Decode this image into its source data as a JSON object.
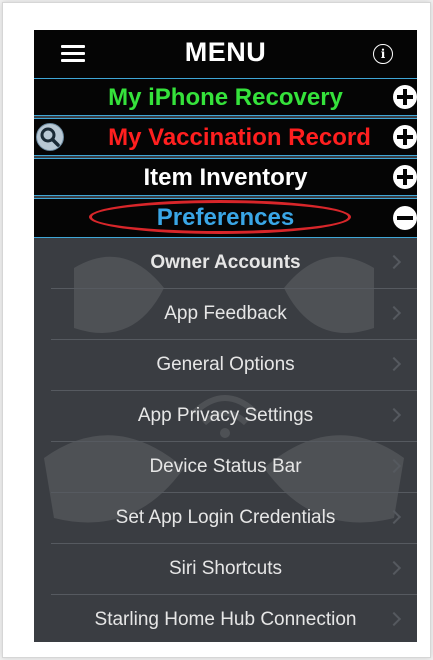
{
  "navbar": {
    "title": "MENU"
  },
  "sections": [
    {
      "label": "My iPhone Recovery",
      "color": "#35e23b",
      "icon": "plus-icon"
    },
    {
      "label": "My Vaccination Record",
      "color": "#ff1f1f",
      "icon": "plus-icon",
      "badge": "search-icon"
    },
    {
      "label": "Item Inventory",
      "color": "#ffffff",
      "icon": "plus-icon"
    },
    {
      "label": "Preferences",
      "color": "#3aa6e6",
      "icon": "minus-icon",
      "highlight_color": "#d8262a"
    }
  ],
  "preferences_items": [
    {
      "label": "Owner Accounts"
    },
    {
      "label": "App Feedback"
    },
    {
      "label": "General Options"
    },
    {
      "label": "App Privacy Settings"
    },
    {
      "label": "Device Status Bar"
    },
    {
      "label": "Set App Login Credentials"
    },
    {
      "label": "Siri Shortcuts"
    },
    {
      "label": "Starling Home Hub Connection"
    }
  ],
  "colors": {
    "header_background": "#050505",
    "header_border": "#3fa6d6",
    "list_background": "#3a3d42",
    "list_text": "#e6e6e6"
  }
}
